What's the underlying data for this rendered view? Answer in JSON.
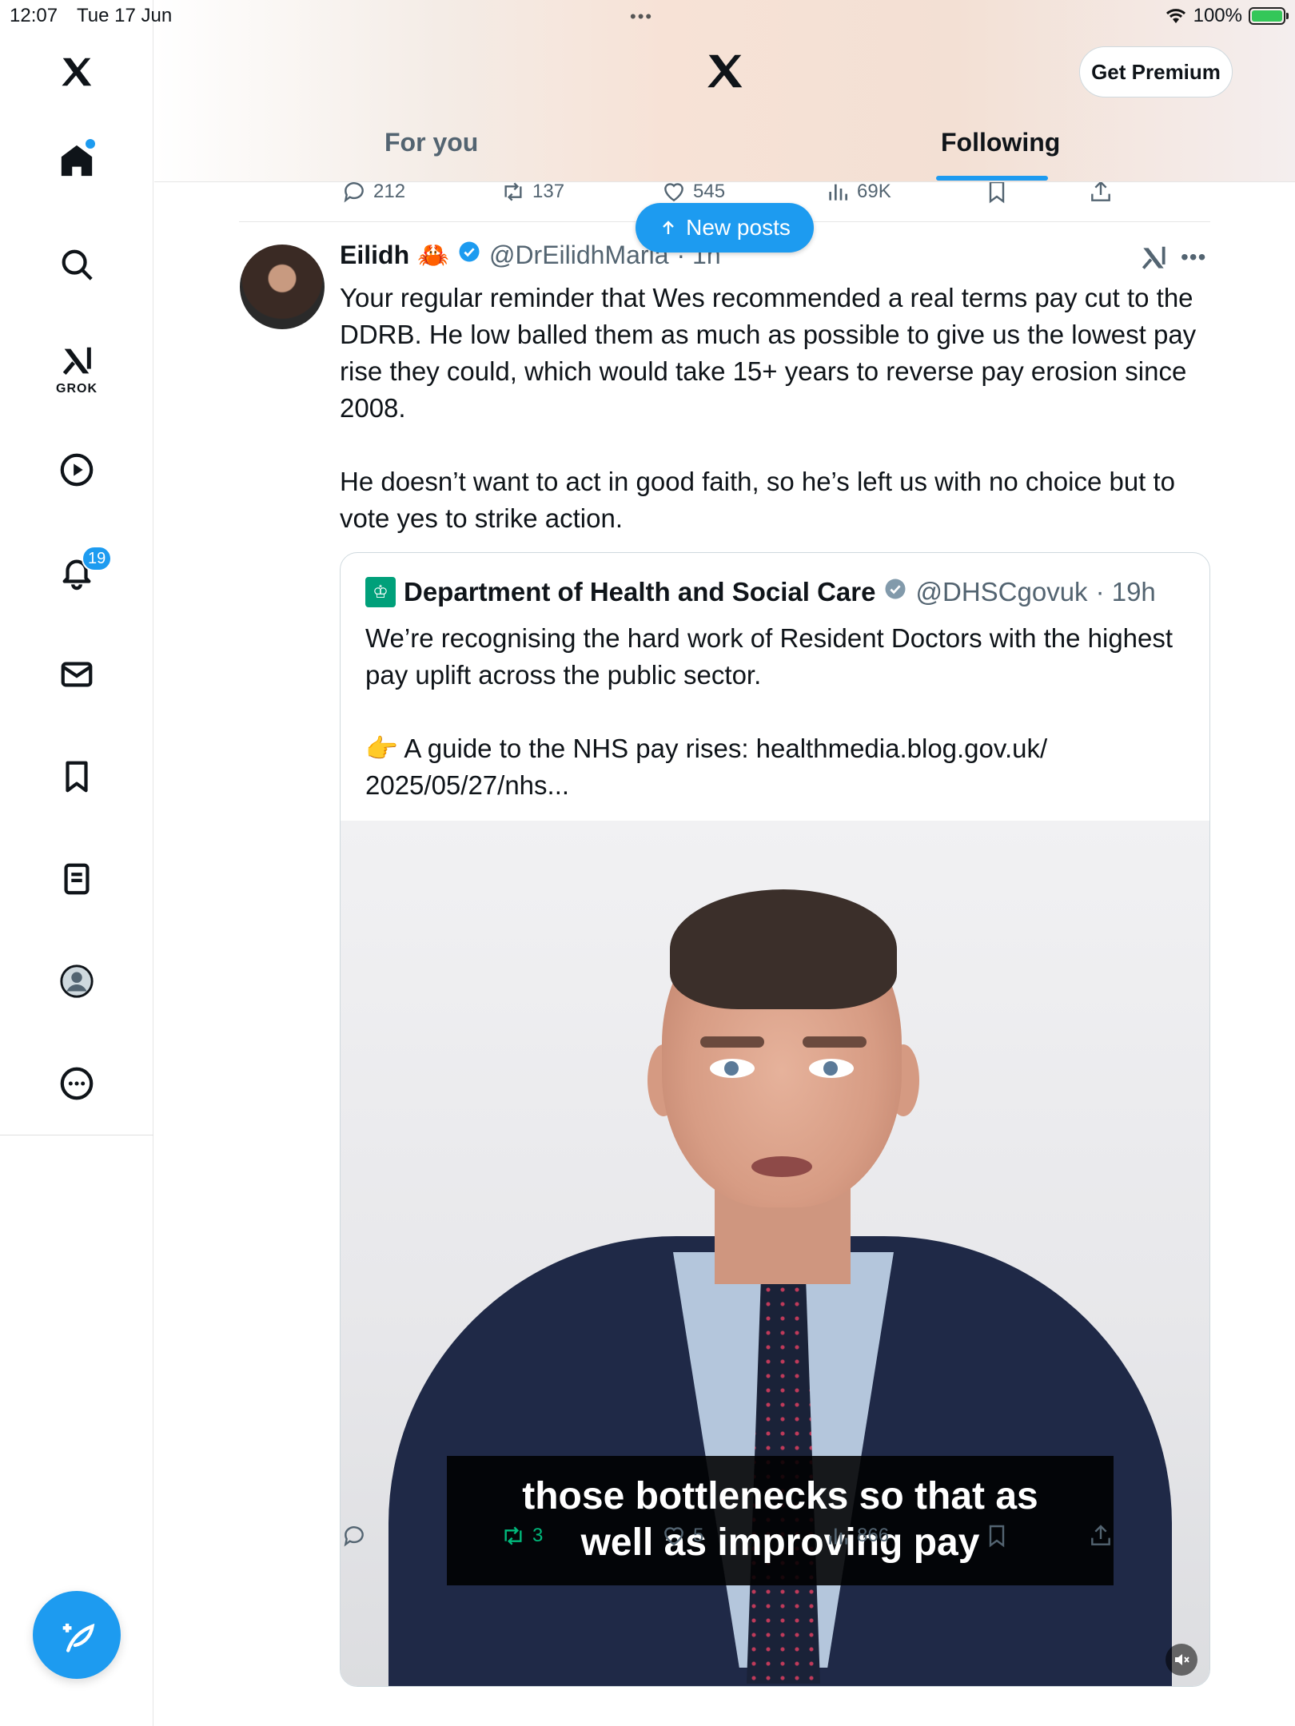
{
  "status_bar": {
    "time": "12:07",
    "date": "Tue 17 Jun",
    "battery": "100%"
  },
  "sidebar": {
    "grok_label": "GROK",
    "notifications_badge": "19",
    "items": [
      {
        "name": "home",
        "icon": "home-icon"
      },
      {
        "name": "explore",
        "icon": "search-icon"
      },
      {
        "name": "grok",
        "icon": "grok-icon"
      },
      {
        "name": "video",
        "icon": "play-icon"
      },
      {
        "name": "notifications",
        "icon": "bell-icon"
      },
      {
        "name": "messages",
        "icon": "mail-icon"
      },
      {
        "name": "bookmarks",
        "icon": "bookmark-icon"
      },
      {
        "name": "lists",
        "icon": "list-icon"
      },
      {
        "name": "profile",
        "icon": "profile-icon"
      },
      {
        "name": "more",
        "icon": "more-icon"
      }
    ]
  },
  "header": {
    "premium_label": "Get Premium",
    "tabs": [
      {
        "label": "For you",
        "active": false
      },
      {
        "label": "Following",
        "active": true
      }
    ]
  },
  "new_posts_label": "New posts",
  "previous_tweet_actions": {
    "replies": "212",
    "reposts": "137",
    "likes": "545",
    "views": "69K"
  },
  "tweet": {
    "name": "Eilidh",
    "emoji": "🦀",
    "handle": "@DrEilidhMaria",
    "time": "· 1h",
    "text": "Your regular reminder that Wes recommended a real terms pay cut to the DDRB. He low balled them as much as possible to give us the lowest pay rise they could, which would take 15+ years to reverse pay erosion since 2008.\n\nHe doesn’t want to act in good faith, so he’s left us with no choice but to vote yes to strike action.",
    "quote": {
      "name": "Department of Health and Social Care",
      "handle": "@DHSCgovuk",
      "time": "· 19h",
      "text": "We’re recognising the hard work of Resident Doctors with the highest pay uplift across the public sector.\n\n👉 A guide to the NHS pay rises: healthmedia.blog.gov.uk/\n2025/05/27/nhs...",
      "video_caption": "those bottlenecks so that as\nwell as improving pay"
    },
    "actions": {
      "replies": "",
      "reposts": "3",
      "likes": "5",
      "views": "866"
    }
  },
  "colors": {
    "accent": "#1d9bf0",
    "retweet": "#00ba7c",
    "muted_text": "#536471"
  }
}
